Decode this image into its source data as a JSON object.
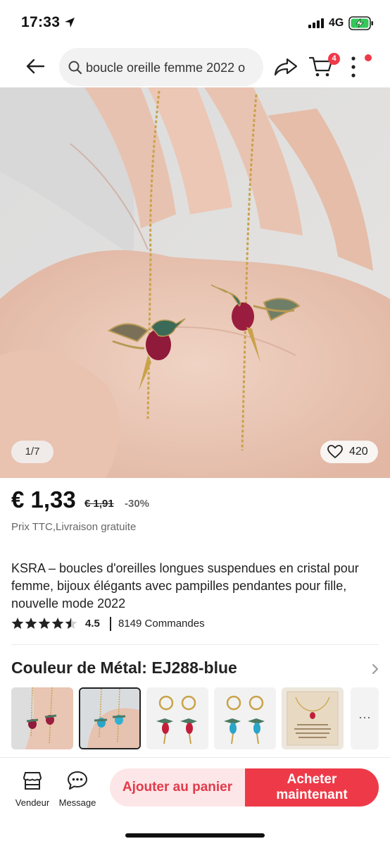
{
  "status_bar": {
    "time": "17:33",
    "network": "4G"
  },
  "nav": {
    "search_text": "boucle oreille femme 2022 o",
    "cart_count": "4"
  },
  "gallery": {
    "counter": "1/7",
    "likes": "420"
  },
  "price": {
    "current": "€ 1,33",
    "original": "€ 1,91",
    "discount": "-30%",
    "note": "Prix TTC,Livraison gratuite"
  },
  "product": {
    "title": "KSRA – boucles d'oreilles longues suspendues en cristal pour femme, bijoux élégants avec pampilles pendantes pour fille, nouvelle mode 2022",
    "rating": "4.5",
    "rating_value": 4.5,
    "orders": "8149 Commandes"
  },
  "variant": {
    "label": "Couleur de Métal: EJ288-blue",
    "more": "···",
    "options": [
      {
        "name": "EJ288-red-chain",
        "selected": false
      },
      {
        "name": "EJ288-blue",
        "selected": true
      },
      {
        "name": "hoop-red",
        "selected": false
      },
      {
        "name": "hoop-blue",
        "selected": false
      },
      {
        "name": "card-necklace",
        "selected": false
      }
    ]
  },
  "bottom_bar": {
    "vendeur": "Vendeur",
    "message": "Message",
    "add_to_cart": "Ajouter au panier",
    "buy_now_line1": "Acheter",
    "buy_now_line2": "maintenant"
  },
  "colors": {
    "accent": "#ee3a48",
    "accent_light": "#fde6e8"
  }
}
